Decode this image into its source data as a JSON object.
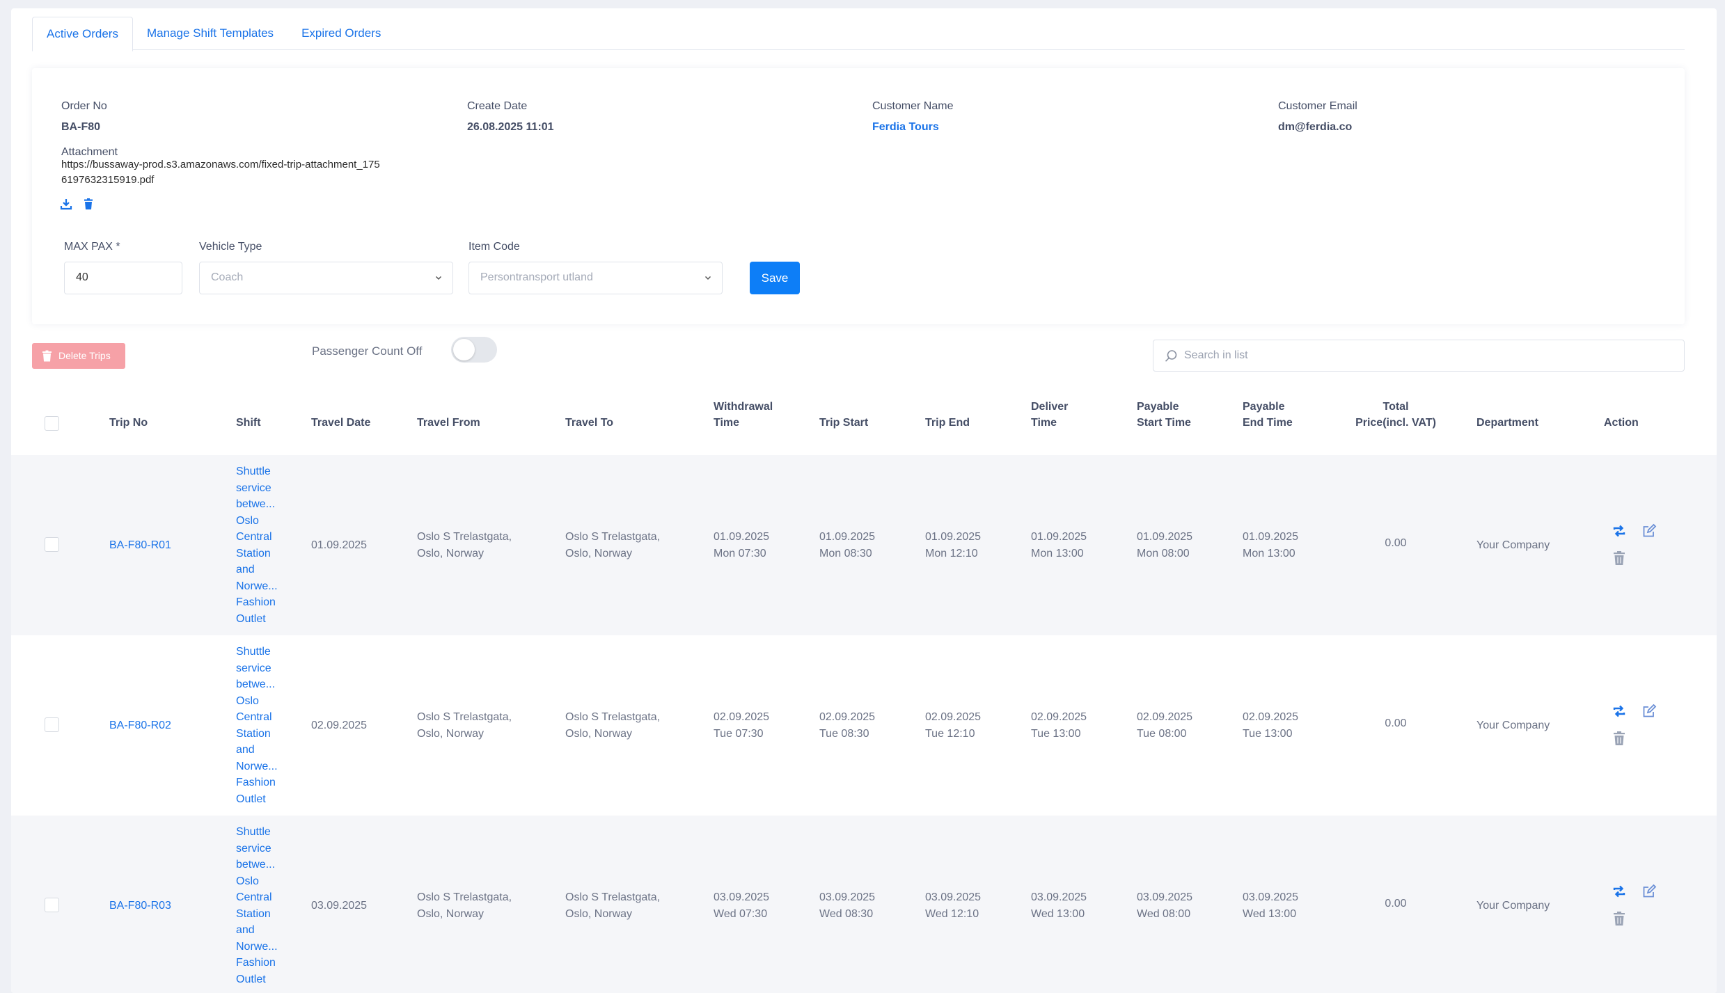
{
  "tabs": [
    {
      "label": "Active Orders",
      "active": true
    },
    {
      "label": "Manage Shift Templates",
      "active": false
    },
    {
      "label": "Expired Orders",
      "active": false
    }
  ],
  "order": {
    "order_no_label": "Order No",
    "order_no": "BA-F80",
    "create_date_label": "Create Date",
    "create_date": "26.08.2025 11:01",
    "customer_name_label": "Customer Name",
    "customer_name": "Ferdia Tours",
    "customer_email_label": "Customer Email",
    "customer_email": "dm@ferdia.co",
    "attachment_label": "Attachment",
    "attachment_url": "https://bussaway-prod.s3.amazonaws.com/fixed-trip-attachment_1756197632315919.pdf"
  },
  "form": {
    "max_pax_label": "MAX PAX *",
    "max_pax_value": "40",
    "vehicle_type_label": "Vehicle Type",
    "vehicle_type_value": "Coach",
    "item_code_label": "Item Code",
    "item_code_value": "Persontransport utland",
    "save_label": "Save"
  },
  "toolbar": {
    "delete_trips_label": "Delete Trips",
    "passenger_count_label": "Passenger Count Off",
    "passenger_count_on": false,
    "search_placeholder": "Search in list"
  },
  "table": {
    "headers": {
      "trip_no": "Trip No",
      "shift": "Shift",
      "travel_date": "Travel Date",
      "travel_from": "Travel From",
      "travel_to": "Travel To",
      "withdrawal_1": "Withdrawal",
      "withdrawal_2": "Time",
      "trip_start": "Trip Start",
      "trip_end": "Trip End",
      "deliver_1": "Deliver",
      "deliver_2": "Time",
      "pay_start_1": "Payable",
      "pay_start_2": "Start Time",
      "pay_end_1": "Payable",
      "pay_end_2": "End Time",
      "total_1": "Total",
      "total_2": "Price(incl. VAT)",
      "department": "Department",
      "action": "Action"
    },
    "rows": [
      {
        "trip_no": "BA-F80-R01",
        "shift": [
          "Shuttle",
          "service",
          "betwe...",
          "Oslo",
          "Central",
          "Station",
          "and",
          "Norwe...",
          "Fashion",
          "Outlet"
        ],
        "travel_date": "01.09.2025",
        "travel_from": [
          "Oslo S Trelastgata,",
          "Oslo, Norway"
        ],
        "travel_to": [
          "Oslo S Trelastgata,",
          "Oslo, Norway"
        ],
        "withdrawal": [
          "01.09.2025",
          "Mon 07:30"
        ],
        "trip_start": [
          "01.09.2025",
          "Mon 08:30"
        ],
        "trip_end": [
          "01.09.2025",
          "Mon 12:10"
        ],
        "deliver": [
          "01.09.2025",
          "Mon 13:00"
        ],
        "pay_start": [
          "01.09.2025",
          "Mon 08:00"
        ],
        "pay_end": [
          "01.09.2025",
          "Mon 13:00"
        ],
        "total": "0.00",
        "department": "Your Company"
      },
      {
        "trip_no": "BA-F80-R02",
        "shift": [
          "Shuttle",
          "service",
          "betwe...",
          "Oslo",
          "Central",
          "Station",
          "and",
          "Norwe...",
          "Fashion",
          "Outlet"
        ],
        "travel_date": "02.09.2025",
        "travel_from": [
          "Oslo S Trelastgata,",
          "Oslo, Norway"
        ],
        "travel_to": [
          "Oslo S Trelastgata,",
          "Oslo, Norway"
        ],
        "withdrawal": [
          "02.09.2025",
          "Tue 07:30"
        ],
        "trip_start": [
          "02.09.2025",
          "Tue 08:30"
        ],
        "trip_end": [
          "02.09.2025",
          "Tue 12:10"
        ],
        "deliver": [
          "02.09.2025",
          "Tue 13:00"
        ],
        "pay_start": [
          "02.09.2025",
          "Tue 08:00"
        ],
        "pay_end": [
          "02.09.2025",
          "Tue 13:00"
        ],
        "total": "0.00",
        "department": "Your Company"
      },
      {
        "trip_no": "BA-F80-R03",
        "shift": [
          "Shuttle",
          "service",
          "betwe...",
          "Oslo",
          "Central",
          "Station",
          "and",
          "Norwe...",
          "Fashion",
          "Outlet"
        ],
        "travel_date": "03.09.2025",
        "travel_from": [
          "Oslo S Trelastgata,",
          "Oslo, Norway"
        ],
        "travel_to": [
          "Oslo S Trelastgata,",
          "Oslo, Norway"
        ],
        "withdrawal": [
          "03.09.2025",
          "Wed 07:30"
        ],
        "trip_start": [
          "03.09.2025",
          "Wed 08:30"
        ],
        "trip_end": [
          "03.09.2025",
          "Wed 12:10"
        ],
        "deliver": [
          "03.09.2025",
          "Wed 13:00"
        ],
        "pay_start": [
          "03.09.2025",
          "Wed 08:00"
        ],
        "pay_end": [
          "03.09.2025",
          "Wed 13:00"
        ],
        "total": "0.00",
        "department": "Your Company"
      }
    ]
  },
  "colors": {
    "accent": "#1a73e8",
    "save_button": "#0d7ef7",
    "delete_button": "#f6a1a7",
    "alt_row": "#f5f6f9"
  },
  "icons": {
    "download": "download-icon",
    "trash": "trash-icon",
    "chevron": "chevron-down-icon",
    "search": "search-icon",
    "repeat": "repeat-icon",
    "edit": "edit-icon"
  }
}
